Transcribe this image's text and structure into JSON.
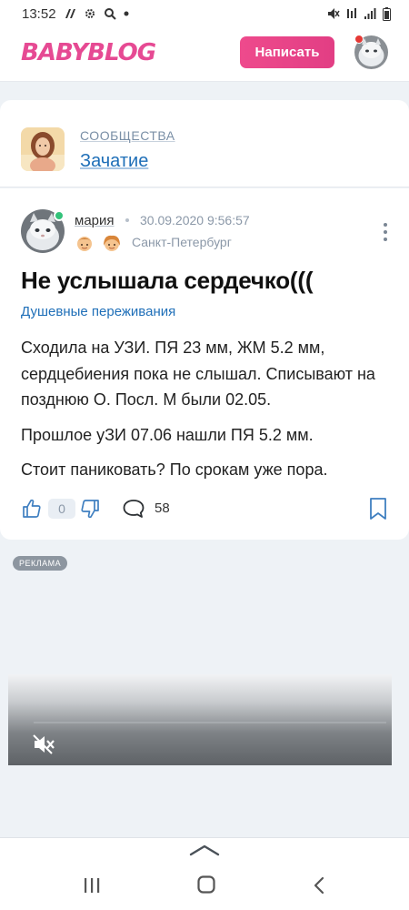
{
  "status_bar": {
    "time": "13:52"
  },
  "header": {
    "logo_text": "BABYBLOG",
    "write_button_label": "Написать"
  },
  "community": {
    "kicker": "СООБЩЕСТВА",
    "title": "Зачатие"
  },
  "post": {
    "author": "мария",
    "date": "30.09.2020 9:56:57",
    "city": "Санкт-Петербург",
    "title": "Не услышала сердечко(((",
    "tag": "Душевные переживания",
    "paragraphs": [
      "Сходила на УЗИ. ПЯ 23 мм, ЖМ 5.2 мм, сердцебиения пока не слышал. Списывают на позднюю О. Посл. М были 02.05.",
      "Прошлое уЗИ 07.06 нашли ПЯ 5.2 мм.",
      "Стоит паниковать? По срокам уже пора."
    ],
    "likes": "0",
    "comments": "58"
  },
  "ad": {
    "badge": "РЕКЛАМА"
  },
  "colors": {
    "brand_pink": "#e64a93",
    "link_blue": "#1f6fb8",
    "online_green": "#34c27a",
    "background": "#eef2f6"
  },
  "icons": [
    "sim-icon",
    "settings-icon",
    "search-icon",
    "mute-icon",
    "alarm-icon",
    "signal-icon",
    "battery-icon",
    "more-vertical-icon",
    "thumb-up-icon",
    "thumb-down-icon",
    "comment-icon",
    "bookmark-icon",
    "volume-mute-icon",
    "chevron-up-icon",
    "recent-apps-icon",
    "home-icon",
    "back-icon"
  ]
}
